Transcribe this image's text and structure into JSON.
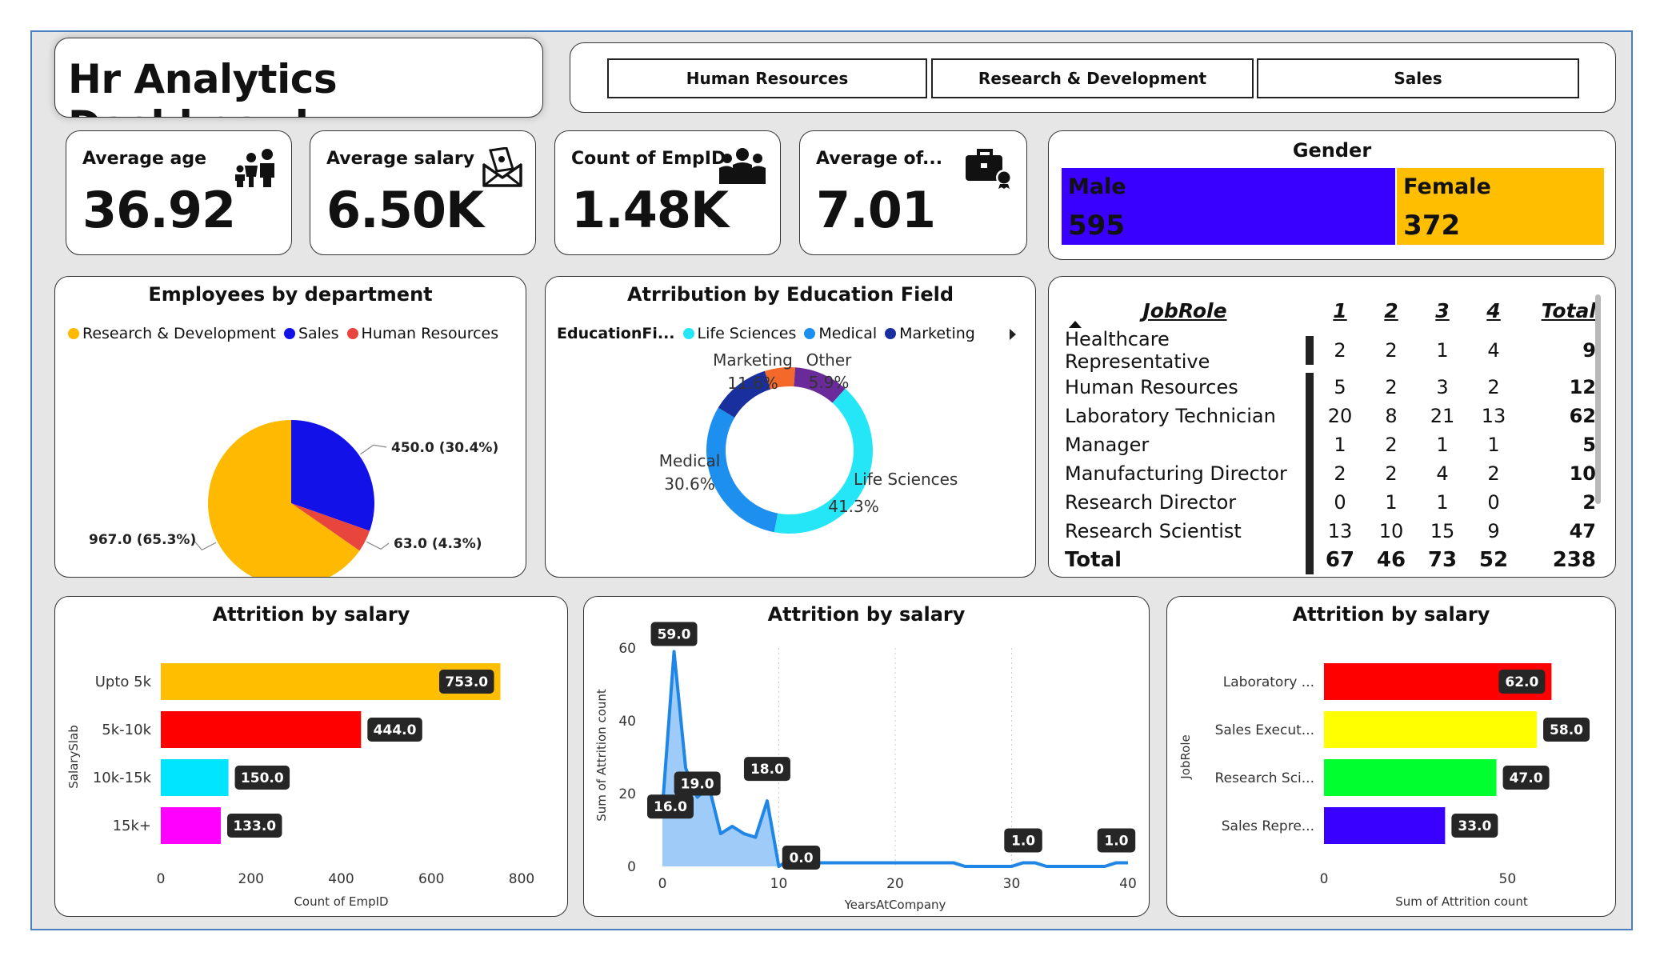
{
  "title": "Hr Analytics Dashboard",
  "slicer": {
    "options": [
      "Human Resources",
      "Research & Development",
      "Sales"
    ]
  },
  "kpis": [
    {
      "label": "Average age",
      "value": "36.92",
      "icon": "family-icon"
    },
    {
      "label": "Average salary",
      "value": "6.50K",
      "icon": "money-envelope-icon"
    },
    {
      "label": "Count of EmpID",
      "value": "1.48K",
      "icon": "team-icon"
    },
    {
      "label": "Average of...",
      "value": "7.01",
      "icon": "briefcase-icon"
    }
  ],
  "gender": {
    "title": "Gender",
    "male": {
      "label": "Male",
      "value": "595",
      "count": 595,
      "color": "#3a00ff"
    },
    "female": {
      "label": "Female",
      "value": "372",
      "count": 372,
      "color": "#ffbf00"
    }
  },
  "chart_data": [
    {
      "type": "pie",
      "title": "Employees by department",
      "legend": [
        "Research & Development",
        "Sales",
        "Human Resources"
      ],
      "colors": [
        "#ffb900",
        "#1212e8",
        "#e8463c"
      ],
      "values": [
        967,
        450,
        63
      ],
      "data_labels": [
        "967.0 (65.3%)",
        "450.0 (30.4%)",
        "63.0 (4.3%)"
      ]
    },
    {
      "type": "pie",
      "title": "Atrribution by Education Field",
      "legend_title": "EducationFi...",
      "legend": [
        "Life Sciences",
        "Medical",
        "Marketing"
      ],
      "categories": [
        "Life Sciences",
        "Medical",
        "Marketing",
        "Other"
      ],
      "percents": [
        41.3,
        30.6,
        11.6,
        5.9
      ],
      "pct_labels": [
        "41.3%",
        "30.6%",
        "11.6%",
        "5.9%"
      ],
      "colors": [
        "#25e6f6",
        "#1d8fee",
        "#1a2f9e",
        "#f4692a",
        "#6a2a9a"
      ]
    },
    {
      "type": "table",
      "columns": [
        "JobRole",
        "1",
        "2",
        "3",
        "4",
        "Total"
      ],
      "rows": [
        {
          "role": "Healthcare Representative",
          "v": [
            "2",
            "2",
            "1",
            "4"
          ],
          "total": "9"
        },
        {
          "role": "Human Resources",
          "v": [
            "5",
            "2",
            "3",
            "2"
          ],
          "total": "12"
        },
        {
          "role": "Laboratory Technician",
          "v": [
            "20",
            "8",
            "21",
            "13"
          ],
          "total": "62"
        },
        {
          "role": "Manager",
          "v": [
            "1",
            "2",
            "1",
            "1"
          ],
          "total": "5"
        },
        {
          "role": "Manufacturing Director",
          "v": [
            "2",
            "2",
            "4",
            "2"
          ],
          "total": "10"
        },
        {
          "role": "Research Director",
          "v": [
            "0",
            "1",
            "1",
            "0"
          ],
          "total": "2"
        },
        {
          "role": "Research Scientist",
          "v": [
            "13",
            "10",
            "15",
            "9"
          ],
          "total": "47"
        }
      ],
      "total_row": {
        "label": "Total",
        "v": [
          "67",
          "46",
          "73",
          "52"
        ],
        "total": "238"
      }
    },
    {
      "type": "bar",
      "title": "Attrition by salary",
      "ylabel": "SalarySlab",
      "xlabel": "Count of EmpID",
      "categories": [
        "Upto 5k",
        "5k-10k",
        "10k-15k",
        "15k+"
      ],
      "values": [
        753,
        444,
        150,
        133
      ],
      "data_labels": [
        "753.0",
        "444.0",
        "150.0",
        "133.0"
      ],
      "colors": [
        "#ffbf00",
        "#ff0000",
        "#00e5ff",
        "#ff00ff"
      ],
      "xlim": [
        0,
        800
      ],
      "xticks": [
        "0",
        "200",
        "400",
        "600",
        "800"
      ]
    },
    {
      "type": "area",
      "title": "Attrition by salary",
      "xlabel": "YearsAtCompany",
      "ylabel": "Sum of Attrition count",
      "x": [
        0,
        1,
        2,
        3,
        4,
        5,
        6,
        7,
        8,
        9,
        10,
        11,
        12,
        13,
        14,
        15,
        16,
        17,
        18,
        19,
        20,
        21,
        22,
        23,
        24,
        25,
        26,
        27,
        28,
        29,
        30,
        31,
        32,
        33,
        34,
        35,
        36,
        37,
        38,
        39,
        40
      ],
      "y": [
        16,
        59,
        27,
        19,
        22,
        9,
        11,
        9,
        8,
        18,
        0,
        2,
        3,
        1,
        1,
        1,
        1,
        1,
        1,
        1,
        1,
        1,
        1,
        1,
        1,
        1,
        0,
        0,
        0,
        0,
        0,
        1,
        1,
        0,
        0,
        0,
        0,
        0,
        0,
        1,
        1
      ],
      "xlim": [
        0,
        40
      ],
      "ylim": [
        0,
        60
      ],
      "xticks": [
        "0",
        "10",
        "20",
        "30",
        "40"
      ],
      "yticks": [
        "0",
        "20",
        "40",
        "60"
      ],
      "annotations": [
        {
          "x": 1,
          "y": 59,
          "text": "59.0"
        },
        {
          "x": 0,
          "y": 16,
          "text": "16.0"
        },
        {
          "x": 3,
          "y": 19,
          "text": "19.0"
        },
        {
          "x": 9,
          "y": 18,
          "text": "18.0"
        },
        {
          "x": 10,
          "y": 0,
          "text": "0.0"
        },
        {
          "x": 31,
          "y": 1,
          "text": "1.0"
        },
        {
          "x": 39,
          "y": 1,
          "text": "1.0"
        }
      ]
    },
    {
      "type": "bar",
      "title": "Attrition by salary",
      "ylabel": "JobRole",
      "xlabel": "Sum of Attrition count",
      "categories": [
        "Laboratory ...",
        "Sales Execut...",
        "Research Sci...",
        "Sales Repre..."
      ],
      "values": [
        62,
        58,
        47,
        33
      ],
      "data_labels": [
        "62.0",
        "58.0",
        "47.0",
        "33.0"
      ],
      "colors": [
        "#ff0000",
        "#ffff00",
        "#00ff2e",
        "#3a00ff"
      ],
      "xlim": [
        0,
        75
      ],
      "xticks": [
        "0",
        "50"
      ]
    }
  ]
}
